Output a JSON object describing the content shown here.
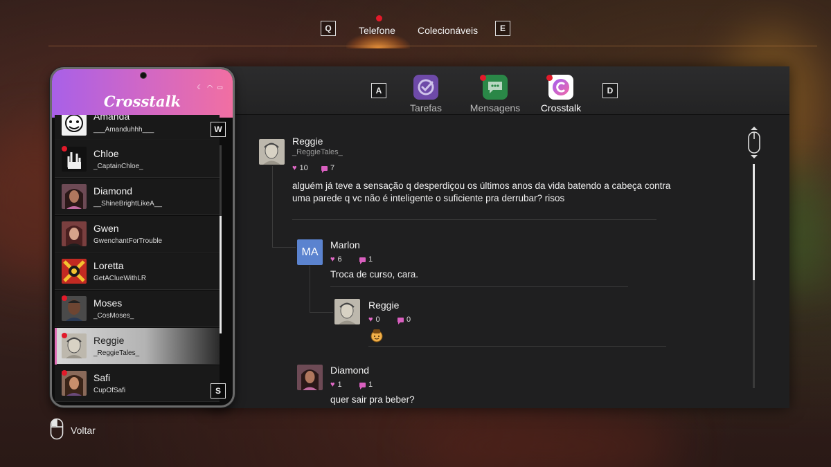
{
  "top_nav": {
    "left_key": "Q",
    "right_key": "E",
    "tabs": [
      {
        "label": "Telefone",
        "active": true,
        "notification": true
      },
      {
        "label": "Colecionáveis",
        "active": false,
        "notification": false
      }
    ]
  },
  "app_bar": {
    "left_key": "A",
    "right_key": "D",
    "apps": [
      {
        "label": "Tarefas",
        "icon": "checkmark-icon",
        "color": "#7a4fb8",
        "notification": false
      },
      {
        "label": "Mensagens",
        "icon": "chat-icon",
        "color": "#2a8f4a",
        "notification": true
      },
      {
        "label": "Crosstalk",
        "icon": "crosstalk-logo-icon",
        "color": "#ffffff",
        "notification": true,
        "active": true
      }
    ]
  },
  "phone": {
    "title": "Crosstalk",
    "up_key": "W",
    "down_key": "S",
    "contacts": [
      {
        "name": "Amanda",
        "handle": "___Amanduhhh___",
        "notification": false,
        "selected": false
      },
      {
        "name": "Chloe",
        "handle": "_CaptainChloe_",
        "notification": true,
        "selected": false
      },
      {
        "name": "Diamond",
        "handle": "__ShineBrightLikeA__",
        "notification": false,
        "selected": false
      },
      {
        "name": "Gwen",
        "handle": "GwenchantForTrouble",
        "notification": false,
        "selected": false
      },
      {
        "name": "Loretta",
        "handle": "GetAClueWithLR",
        "notification": false,
        "selected": false
      },
      {
        "name": "Moses",
        "handle": "_CosMoses_",
        "notification": true,
        "selected": false
      },
      {
        "name": "Reggie",
        "handle": "_ReggieTales_",
        "notification": true,
        "selected": true
      },
      {
        "name": "Safi",
        "handle": "CupOfSafi",
        "notification": true,
        "selected": false
      }
    ]
  },
  "thread": {
    "main_post": {
      "author": "Reggie",
      "handle": "_ReggieTales_",
      "likes": "10",
      "comments": "7",
      "text_line1": "alguém já teve a sensação q desperdiçou os últimos anos da vida batendo a cabeça contra",
      "text_line2": "uma parede q vc não é inteligente o suficiente pra derrubar? risos"
    },
    "replies": [
      {
        "author": "Marlon",
        "avatar_text": "MA",
        "likes": "6",
        "comments": "1",
        "text": "Troca de curso, cara."
      },
      {
        "author": "Reggie",
        "likes": "0",
        "comments": "0",
        "text": ""
      },
      {
        "author": "Diamond",
        "likes": "1",
        "comments": "1",
        "text": "quer sair pra beber?"
      }
    ]
  },
  "footer": {
    "back_label": "Voltar"
  }
}
